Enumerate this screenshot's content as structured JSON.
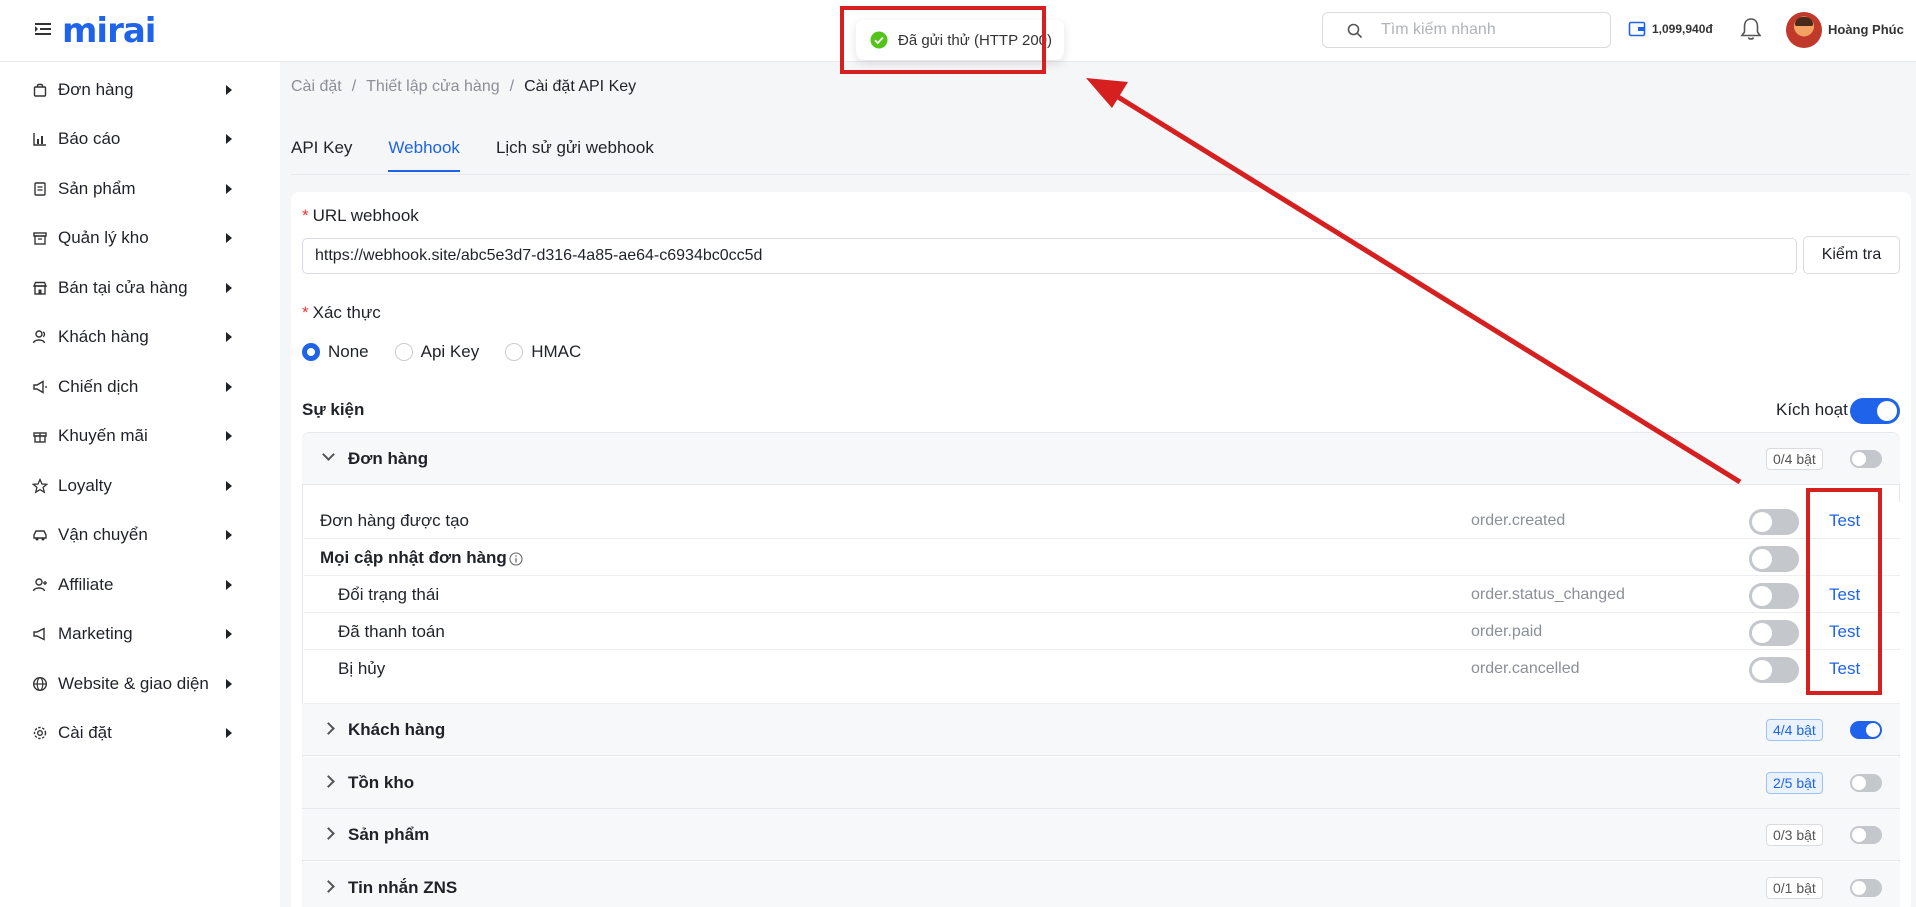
{
  "header": {
    "logo": "mirai",
    "search_placeholder": "Tìm kiếm nhanh",
    "wallet_amount": "1,099,940đ",
    "username": "Hoàng Phúc"
  },
  "toast": {
    "message": "Đã gửi thử (HTTP 200)"
  },
  "sidebar": {
    "items": [
      {
        "label": "Đơn hàng",
        "icon": "bag-icon"
      },
      {
        "label": "Báo cáo",
        "icon": "chart-icon"
      },
      {
        "label": "Sản phẩm",
        "icon": "product-icon"
      },
      {
        "label": "Quản lý kho",
        "icon": "warehouse-icon"
      },
      {
        "label": "Bán tại cửa hàng",
        "icon": "store-icon"
      },
      {
        "label": "Khách hàng",
        "icon": "users-icon"
      },
      {
        "label": "Chiến dịch",
        "icon": "megaphone-icon"
      },
      {
        "label": "Khuyến mãi",
        "icon": "gift-icon"
      },
      {
        "label": "Loyalty",
        "icon": "star-icon"
      },
      {
        "label": "Vận chuyển",
        "icon": "car-icon"
      },
      {
        "label": "Affiliate",
        "icon": "affiliate-icon"
      },
      {
        "label": "Marketing",
        "icon": "flag-icon"
      },
      {
        "label": "Website & giao diện",
        "icon": "globe-icon"
      },
      {
        "label": "Cài đặt",
        "icon": "gear-icon"
      }
    ]
  },
  "breadcrumb": {
    "items": [
      "Cài đặt",
      "Thiết lập cửa hàng",
      "Cài đặt API Key"
    ],
    "sep": "/"
  },
  "tabs": [
    {
      "label": "API Key",
      "active": false
    },
    {
      "label": "Webhook",
      "active": true
    },
    {
      "label": "Lịch sử gửi webhook",
      "active": false
    }
  ],
  "form": {
    "url_label": "URL webhook",
    "url_value": "https://webhook.site/abc5e3d7-d316-4a85-ae64-c6934bc0cc5d",
    "check_button": "Kiểm tra",
    "auth_label": "Xác thực",
    "auth_options": [
      "None",
      "Api Key",
      "HMAC"
    ],
    "auth_selected": "None",
    "required_mark": "*"
  },
  "events": {
    "title": "Sự kiện",
    "activate_label": "Kích hoạt",
    "activate_on": true,
    "groups": [
      {
        "name": "Đơn hàng",
        "badge": "0/4 bật",
        "on": false,
        "expanded": true
      },
      {
        "name": "Khách hàng",
        "badge": "4/4 bật",
        "on": true,
        "expanded": false
      },
      {
        "name": "Tồn kho",
        "badge": "2/5 bật",
        "on": false,
        "expanded": false
      },
      {
        "name": "Sản phẩm",
        "badge": "0/3 bật",
        "on": false,
        "expanded": false
      },
      {
        "name": "Tin nhắn ZNS",
        "badge": "0/1 bật",
        "on": false,
        "expanded": false
      }
    ],
    "order_events": [
      {
        "name": "Đơn hàng được tạo",
        "key": "order.created",
        "test": "Test",
        "on": false
      },
      {
        "name": "Mọi cập nhật đơn hàng",
        "key": "",
        "test": "",
        "on": false
      },
      {
        "name": "Đổi trạng thái",
        "key": "order.status_changed",
        "test": "Test",
        "on": false
      },
      {
        "name": "Đã thanh toán",
        "key": "order.paid",
        "test": "Test",
        "on": false
      },
      {
        "name": "Bị hủy",
        "key": "order.cancelled",
        "test": "Test",
        "on": false
      }
    ]
  },
  "colors": {
    "accent": "#1e63e9",
    "annotation": "#d62020",
    "success": "#52c41a"
  }
}
